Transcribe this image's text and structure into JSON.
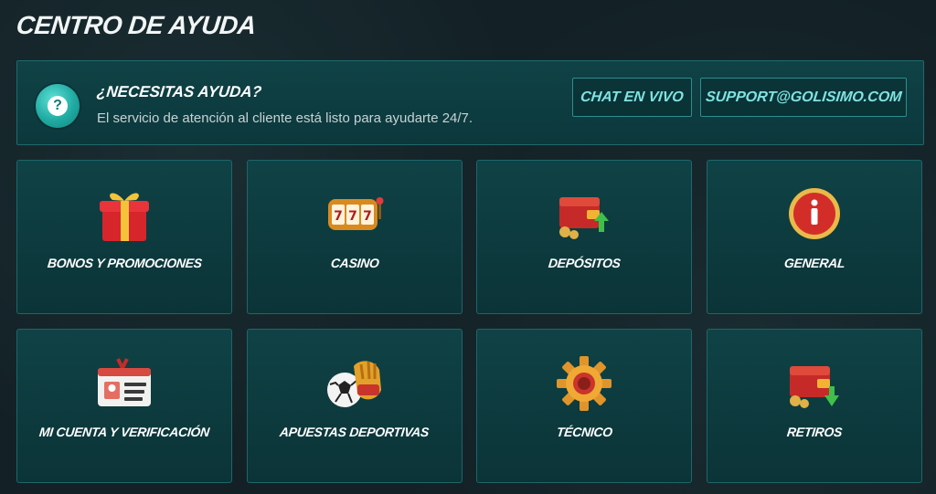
{
  "page": {
    "title": "CENTRO DE AYUDA"
  },
  "banner": {
    "title": "¿NECESITAS AYUDA?",
    "subtitle": "El servicio de atención al cliente está listo para ayudarte 24/7.",
    "icon": "question-icon",
    "chat_label": "CHAT EN VIVO",
    "email_label": "SUPPORT@GOLISIMO.COM"
  },
  "categories": [
    {
      "label": "BONOS Y PROMOCIONES",
      "icon": "gift-icon"
    },
    {
      "label": "CASINO",
      "icon": "slot-machine-icon"
    },
    {
      "label": "DEPÓSITOS",
      "icon": "wallet-deposit-icon"
    },
    {
      "label": "GENERAL",
      "icon": "info-icon"
    },
    {
      "label": "MI CUENTA Y VERIFICACIÓN",
      "icon": "id-card-icon"
    },
    {
      "label": "APUESTAS DEPORTIVAS",
      "icon": "soccer-glove-icon"
    },
    {
      "label": "TÉCNICO",
      "icon": "gear-icon"
    },
    {
      "label": "RETIROS",
      "icon": "wallet-withdraw-icon"
    }
  ],
  "colors": {
    "accent": "#7fe3e1",
    "card_bg": "#0f4246",
    "border": "#1e6669",
    "page_bg": "#132126"
  }
}
